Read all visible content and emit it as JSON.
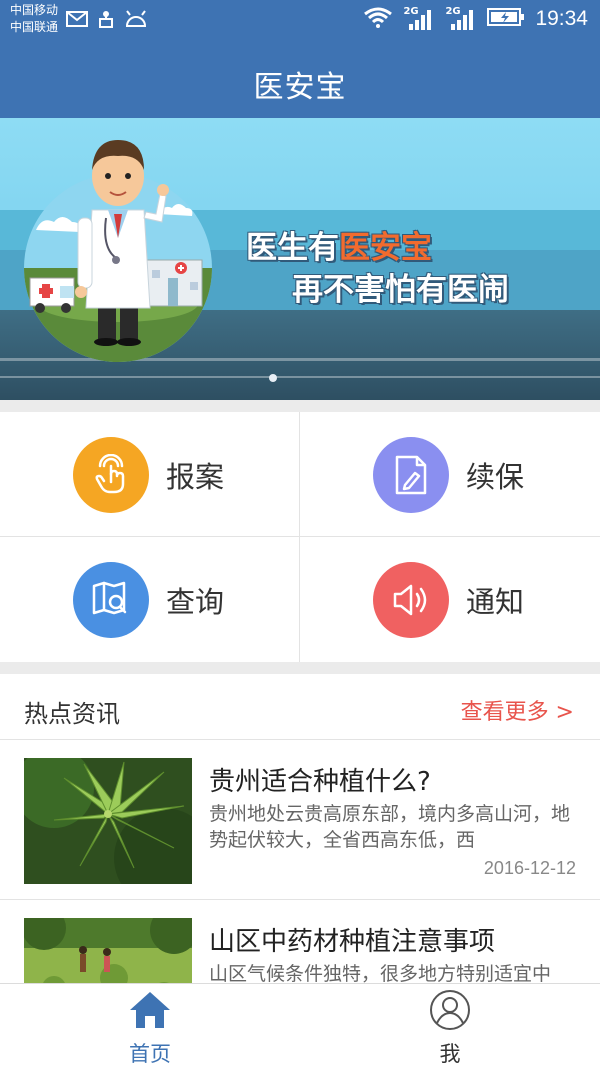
{
  "status_bar": {
    "carrier_1": "中国移动",
    "carrier_2": "中国联通",
    "network_1": "2G",
    "network_2": "2G",
    "time": "19:34",
    "icons": [
      "mail-icon",
      "usb-icon",
      "android-icon",
      "wifi-icon",
      "signal-icon",
      "battery-charging-icon"
    ]
  },
  "app": {
    "title": "医安宝"
  },
  "banner": {
    "line1_prefix": "医生有",
    "line1_highlight": "医安宝",
    "line2": "再不害怕有医闹",
    "indicator_count": 1,
    "active_index": 0
  },
  "grid": {
    "items": [
      {
        "label": "报案",
        "icon": "touch-hand-icon",
        "color": "#f5a623"
      },
      {
        "label": "续保",
        "icon": "document-edit-icon",
        "color": "#8a8ff0"
      },
      {
        "label": "查询",
        "icon": "book-search-icon",
        "color": "#4a90e2"
      },
      {
        "label": "通知",
        "icon": "speaker-icon",
        "color": "#f06161"
      }
    ]
  },
  "news": {
    "section_title": "热点资讯",
    "more_label": "查看更多 >",
    "items": [
      {
        "title": "贵州适合种植什么?",
        "desc": "贵州地处云贵高原东部，境内多高山河，地势起伏较大，全省西高东低，西",
        "date": "2016-12-12"
      },
      {
        "title": "山区中药材种植注意事项",
        "desc": "山区气候条件独特，很多地方特别适宜中",
        "date": ""
      }
    ]
  },
  "bottom_nav": {
    "items": [
      {
        "label": "首页",
        "icon": "home-icon",
        "active": true
      },
      {
        "label": "我",
        "icon": "user-icon",
        "active": false
      }
    ],
    "active_color": "#3e73b3",
    "inactive_color": "#333333"
  }
}
